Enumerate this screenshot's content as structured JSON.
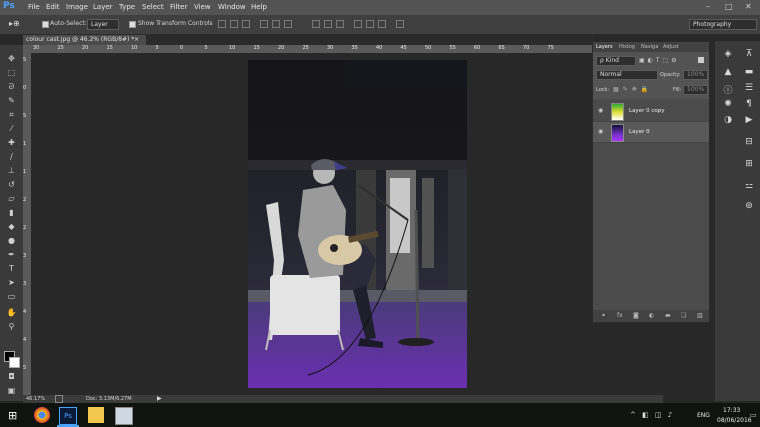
{
  "app": {
    "logo": "Ps"
  },
  "menu": [
    "File",
    "Edit",
    "Image",
    "Layer",
    "Type",
    "Select",
    "Filter",
    "View",
    "Window",
    "Help"
  ],
  "window_controls": {
    "minimize": "–",
    "maximize": "□",
    "close": "✕"
  },
  "options": {
    "auto_select_label": "Auto-Select:",
    "auto_select_value": "Layer",
    "transform_label": "Show Transform Controls",
    "workspace": "Photography"
  },
  "document": {
    "tab_title": "colour cast.jpg @ 46.2% (RGB/8#) *",
    "tab_close": "×"
  },
  "ruler_h": [
    "30",
    "25",
    "20",
    "15",
    "10",
    "5",
    "0",
    "5",
    "10",
    "15",
    "20",
    "25",
    "30",
    "35",
    "40",
    "45",
    "50",
    "55",
    "60",
    "65",
    "70",
    "75"
  ],
  "ruler_v": [
    "5",
    "0",
    "5",
    "1",
    "1",
    "2",
    "2",
    "3",
    "3",
    "4",
    "4",
    "5"
  ],
  "status": {
    "zoom": "46.17%",
    "doc": "Doc: 3.13M/6.27M"
  },
  "layers_panel": {
    "tabs": [
      "Layers",
      "Histog",
      "Naviga",
      "Adjust"
    ],
    "filter_label": "ρ Kind",
    "blend_mode": "Normal",
    "opacity_label": "Opacity:",
    "opacity_value": "100%",
    "lock_label": "Lock:",
    "fill_label": "Fill:",
    "fill_value": "100%",
    "layers": [
      {
        "name": "Layer 0 copy"
      },
      {
        "name": "Layer 0"
      }
    ],
    "footer_icons": [
      "link-icon",
      "fx-icon",
      "mask-icon",
      "adjustment-icon",
      "folder-icon",
      "new-layer-icon",
      "trash-icon"
    ]
  },
  "taskbar": {
    "time": "17:33",
    "date": "08/06/2016",
    "lang": "ENG"
  }
}
